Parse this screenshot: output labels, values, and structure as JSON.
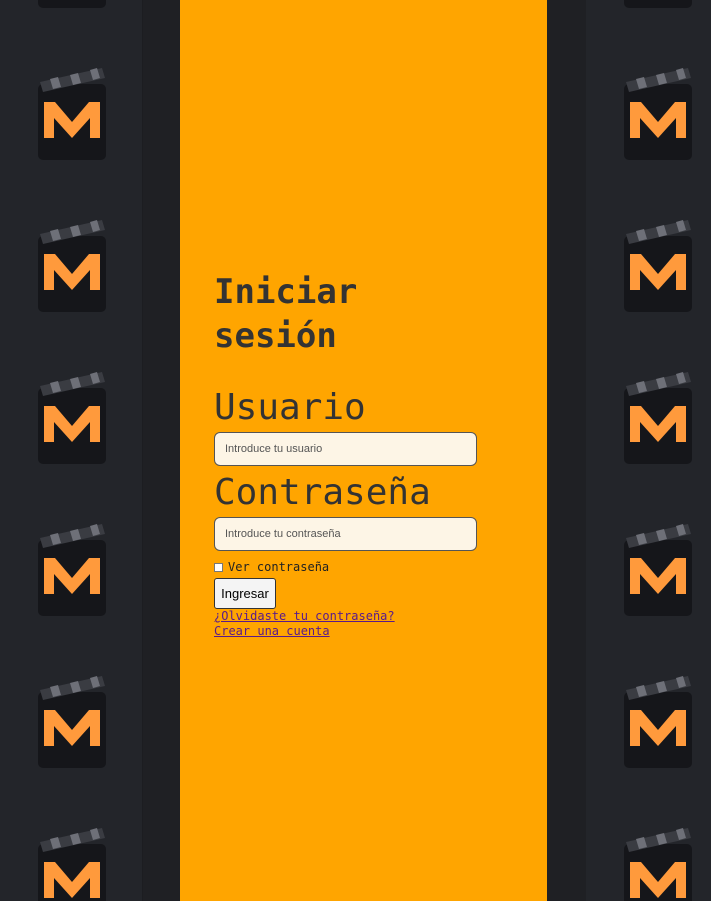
{
  "login": {
    "title": "Iniciar sesión",
    "username_label": "Usuario",
    "username_placeholder": "Introduce tu usuario",
    "password_label": "Contraseña",
    "password_placeholder": "Introduce tu contraseña",
    "show_password_label": "Ver contraseña",
    "submit_label": "Ingresar",
    "forgot_link": "¿Olvidaste tu contraseña?",
    "create_link": "Crear una cuenta"
  },
  "background": {
    "logo_icon": "clapperboard-m-logo-icon",
    "logo_letter": "M",
    "logo_color": "#ff9a3c",
    "tile_color": "#23252a"
  },
  "colors": {
    "panel": "#ffa500",
    "input_bg": "#fdf5e6",
    "text": "#333333",
    "link": "#5a1a8a"
  }
}
